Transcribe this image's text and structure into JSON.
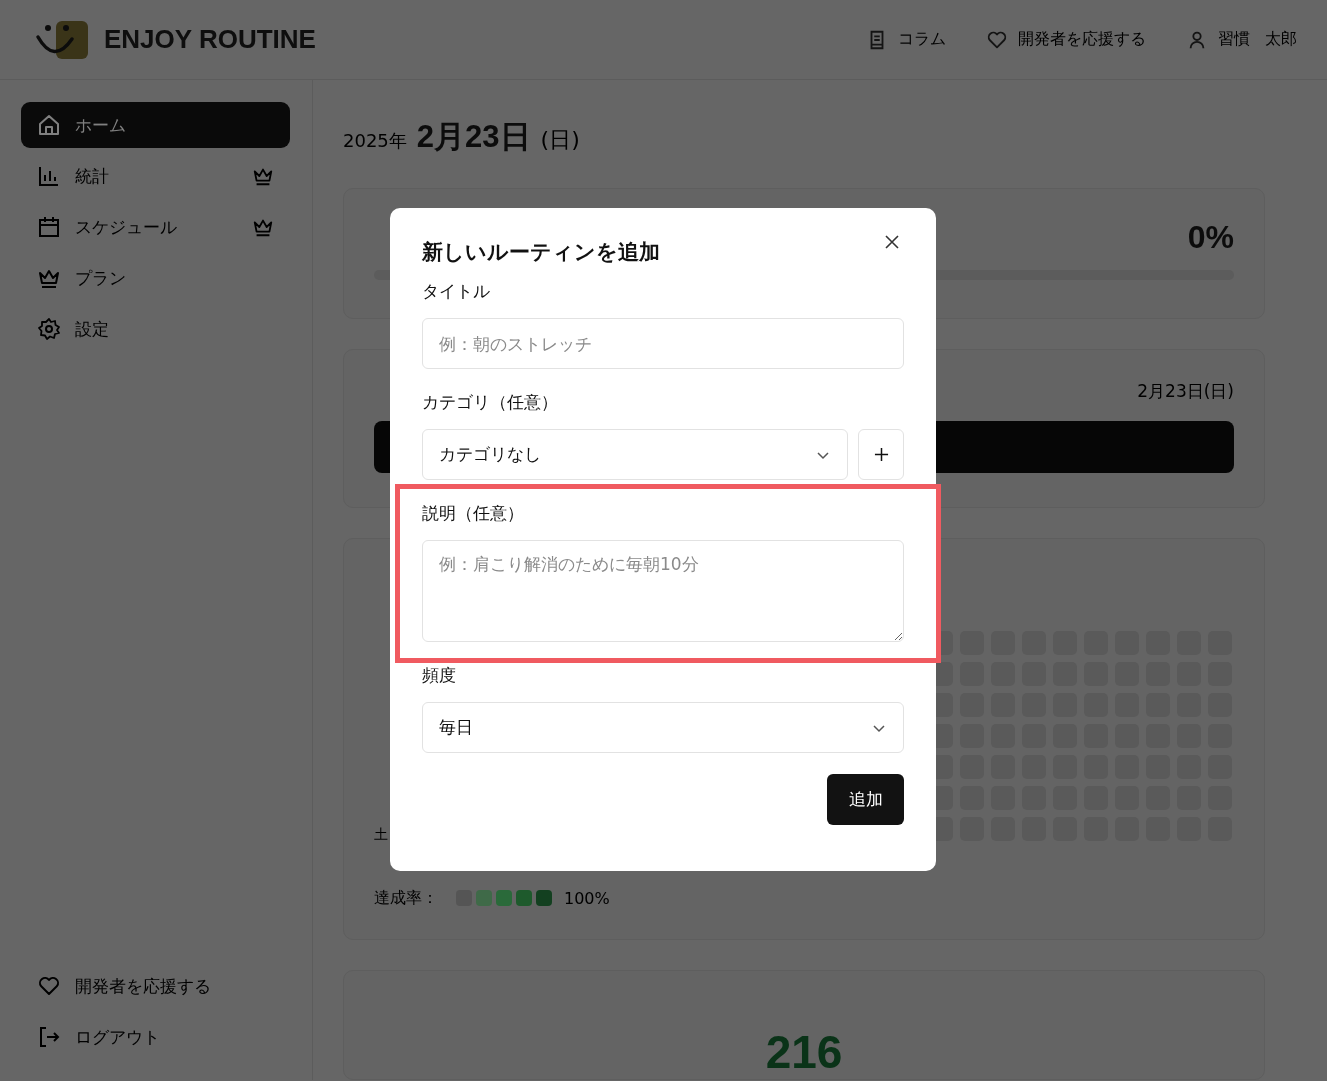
{
  "header": {
    "logo_text": "ENJOY ROUTINE",
    "nav": [
      "コラム",
      "開発者を応援する"
    ],
    "user_name": "習慣 太郎"
  },
  "sidebar": {
    "items": [
      {
        "label": "ホーム",
        "selected": true,
        "premium": false
      },
      {
        "label": "統計",
        "selected": false,
        "premium": true
      },
      {
        "label": "スケジュール",
        "selected": false,
        "premium": true
      },
      {
        "label": "プラン",
        "selected": false,
        "premium": false
      },
      {
        "label": "設定",
        "selected": false,
        "premium": false
      }
    ],
    "footer_items": [
      "開発者を応援する",
      "ログアウト"
    ]
  },
  "main": {
    "year": "2025年",
    "date": "2月23日",
    "weekday": "(日)",
    "progress_card": {
      "percent": "0%",
      "level": 0
    },
    "today_card": {
      "date": "2月23日(日)"
    },
    "heatmap_card": {
      "day_labels": [
        "土"
      ],
      "legend_label": "達成率：",
      "legend": [
        {
          "color": "#555555"
        },
        {
          "color": "#3f6a48"
        },
        {
          "color": "#2a6a3a"
        },
        {
          "color": "#1e5a2c"
        },
        {
          "color": "#134020"
        }
      ],
      "legend_max": "100%"
    },
    "stats_card": {
      "value": "216"
    }
  },
  "modal": {
    "title": "新しいルーティンを追加",
    "fields": [
      {
        "kind": "text",
        "label": "タイトル",
        "placeholder": "例：朝のストレッチ"
      },
      {
        "kind": "select",
        "label": "カテゴリ（任意）",
        "value": "カテゴリなし",
        "add_button": true
      },
      {
        "kind": "textarea",
        "label": "説明（任意）",
        "placeholder": "例：肩こり解消のために毎朝10分",
        "highlighted": true
      },
      {
        "kind": "select",
        "label": "頻度",
        "value": "毎日"
      }
    ],
    "submit": "追加"
  }
}
